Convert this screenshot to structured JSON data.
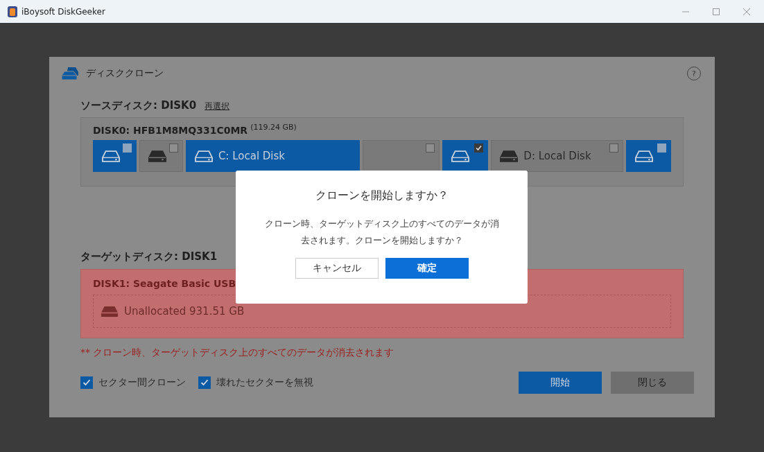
{
  "window": {
    "title": "iBoysoft DiskGeeker"
  },
  "panel": {
    "title": "ディスククローン",
    "help": "?"
  },
  "source": {
    "heading": "ソースディスク: DISK0",
    "reselect": "再選択",
    "disk_name": "DISK0: HFB1M8MQ331C0MR",
    "disk_size": "(119.24 GB)",
    "partitions": [
      {
        "kind": "drive",
        "selected": true,
        "checked": false
      },
      {
        "kind": "drive",
        "selected": false,
        "checked": false
      },
      {
        "kind": "drive",
        "label": "C: Local Disk",
        "selected": true
      },
      {
        "kind": "blank",
        "selected": false,
        "checked": false
      },
      {
        "kind": "drive",
        "selected": true,
        "checked": true
      },
      {
        "kind": "drive",
        "label": "D: Local Disk",
        "selected": false,
        "checked": false
      },
      {
        "kind": "drive",
        "selected": true,
        "checked": false
      }
    ]
  },
  "target": {
    "heading": "ターゲットディスク: DISK1",
    "disk_name": "DISK1: Seagate Basic USB",
    "space": "Unallocated 931.51 GB"
  },
  "warning": "** クローン時、ターゲットディスク上のすべてのデータが消去されます",
  "options": [
    {
      "label": "セクター間クローン",
      "checked": true
    },
    {
      "label": "壊れたセクターを無視",
      "checked": true
    }
  ],
  "buttons": [
    {
      "label": "開始",
      "primary": true
    },
    {
      "label": "閉じる",
      "primary": false
    }
  ],
  "dialog": {
    "title": "クローンを開始しますか？",
    "message": "クローン時、ターゲットディスク上のすべてのデータが消去されます。クローンを開始しますか？",
    "cancel": "キャンセル",
    "confirm": "確定"
  }
}
